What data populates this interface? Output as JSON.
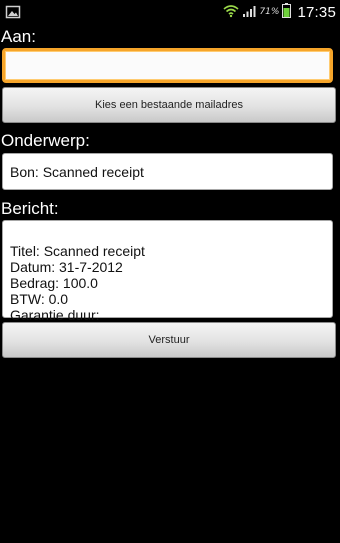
{
  "status_bar": {
    "battery_percent": "71%",
    "time": "17:35",
    "icons": [
      "image-icon",
      "wifi-icon",
      "signal-icon",
      "battery-icon"
    ]
  },
  "form": {
    "to_label": "Aan:",
    "to_value": "",
    "choose_address_button": "Kies een bestaande mailadres",
    "subject_label": "Onderwerp:",
    "subject_value": "Bon: Scanned receipt",
    "message_label": "Bericht:",
    "message_value": "Titel: Scanned receipt\nDatum: 31-7-2012\nBedrag: 100.0\nBTW: 0.0\nGarantie duur:",
    "send_button": "Verstuur"
  },
  "colors": {
    "focus_accent": "#f6a52a",
    "battery_green": "#6fd23c",
    "background": "#000000"
  }
}
